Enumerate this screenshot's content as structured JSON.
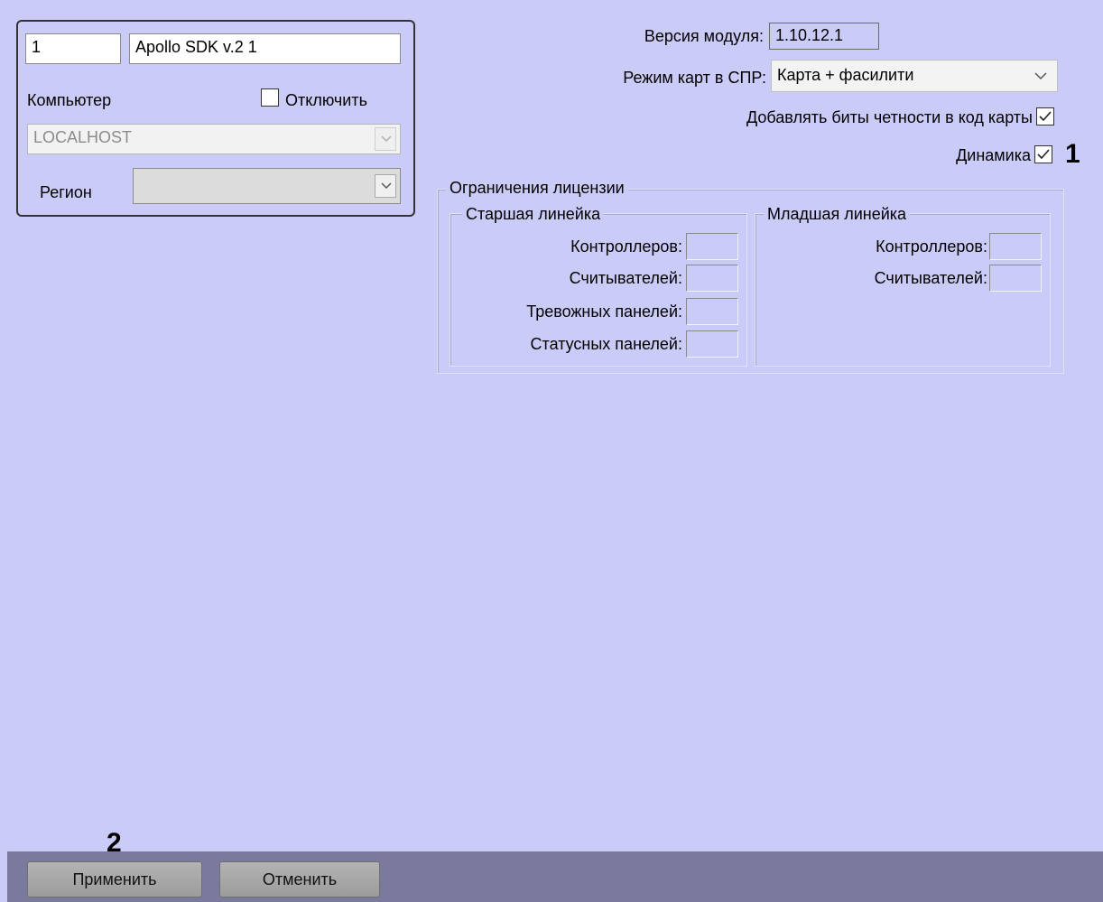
{
  "left_panel": {
    "id_value": "1",
    "name_value": "Apollo SDK v.2 1",
    "computer_label": "Компьютер",
    "disable_label": "Отключить",
    "disable_checked": false,
    "computer_value": "LOCALHOST",
    "region_label": "Регион",
    "region_value": ""
  },
  "settings": {
    "module_version_label": "Версия модуля:",
    "module_version_value": "1.10.12.1",
    "card_mode_label": "Режим карт в СПР:",
    "card_mode_value": "Карта + фасилити",
    "parity_label": "Добавлять биты четности в код карты",
    "parity_checked": true,
    "dynamics_label": "Динамика",
    "dynamics_checked": true
  },
  "license": {
    "title": "Ограничения лицензии",
    "senior": {
      "title": "Старшая линейка",
      "rows": [
        {
          "label": "Контроллеров:",
          "value": ""
        },
        {
          "label": "Считывателей:",
          "value": ""
        },
        {
          "label": "Тревожных панелей:",
          "value": ""
        },
        {
          "label": "Статусных панелей:",
          "value": ""
        }
      ]
    },
    "junior": {
      "title": "Младшая линейка",
      "rows": [
        {
          "label": "Контроллеров:",
          "value": ""
        },
        {
          "label": "Считывателей:",
          "value": ""
        }
      ]
    }
  },
  "buttons": {
    "apply": "Применить",
    "cancel": "Отменить"
  },
  "annotations": {
    "one": "1",
    "two": "2"
  },
  "colors": {
    "background": "#cbcbf8",
    "bottom_bar": "#7a7a9c"
  }
}
